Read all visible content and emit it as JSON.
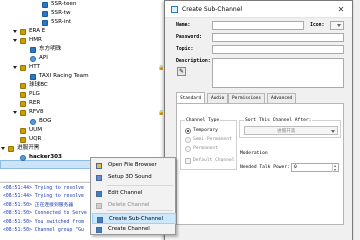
{
  "tree": {
    "rows": [
      {
        "label": "5SR-teen",
        "level": 3,
        "icon": "blue",
        "caret": false,
        "bold": false
      },
      {
        "label": "5SR-tw",
        "level": 3,
        "icon": "blue",
        "caret": false,
        "bold": false
      },
      {
        "label": "5SR-int",
        "level": 3,
        "icon": "blue",
        "caret": false,
        "bold": false
      },
      {
        "label": "ERA E",
        "level": 1,
        "icon": "yellow",
        "caret": true,
        "bold": false
      },
      {
        "label": "HMR",
        "level": 1,
        "icon": "yellow",
        "caret": true,
        "bold": false
      },
      {
        "label": "东方明珠",
        "level": 2,
        "icon": "blue",
        "caret": false,
        "bold": false
      },
      {
        "label": "API",
        "level": 2,
        "icon": "user",
        "caret": false,
        "bold": false
      },
      {
        "label": "HTT",
        "level": 1,
        "icon": "yellow",
        "caret": true,
        "bold": false
      },
      {
        "label": "TAXI Racing Team",
        "level": 2,
        "icon": "blue",
        "caret": false,
        "bold": false
      },
      {
        "label": "球球BC",
        "level": 1,
        "icon": "yellow",
        "caret": false,
        "bold": false
      },
      {
        "label": "PLG",
        "level": 1,
        "icon": "yellow",
        "caret": false,
        "bold": false
      },
      {
        "label": "RER",
        "level": 1,
        "icon": "yellow",
        "caret": false,
        "bold": false
      },
      {
        "label": "RFV8",
        "level": 1,
        "icon": "yellow",
        "caret": true,
        "bold": false
      },
      {
        "label": "BOG",
        "level": 2,
        "icon": "user",
        "caret": false,
        "bold": false
      },
      {
        "label": "UUM",
        "level": 1,
        "icon": "yellow",
        "caret": false,
        "bold": false
      },
      {
        "label": "UQR",
        "level": 1,
        "icon": "yellow",
        "caret": false,
        "bold": false
      },
      {
        "label": "进服开黑",
        "level": 0,
        "icon": "yellow",
        "caret": true,
        "bold": false
      },
      {
        "label": "hacker303",
        "level": 1,
        "icon": "user",
        "caret": false,
        "bold": true
      }
    ]
  },
  "chat": {
    "lines": [
      "<08:51:44> Trying to resolve",
      "<08:51:44> Trying to resolve",
      "<08:51:50> 正在连接到服务器",
      "<08:51:50> Connected to Serve",
      "<08:51:50> You switched from",
      "<08:51:50> Channel group \"Gu"
    ]
  },
  "context_menu": {
    "items": [
      {
        "label": "Open File Browser",
        "icon": "folder-icon",
        "disabled": false,
        "highlight": false
      },
      {
        "label": "Setup 3D Sound",
        "icon": "sound-icon",
        "disabled": false,
        "highlight": false
      },
      {
        "label": "Edit Channel",
        "icon": "edit-icon",
        "disabled": false,
        "highlight": false
      },
      {
        "label": "Delete Channel",
        "icon": "delete-icon",
        "disabled": true,
        "highlight": false
      },
      {
        "label": "Create Sub-Channel",
        "icon": "add-subchannel-icon",
        "disabled": false,
        "highlight": true
      },
      {
        "label": "Create Channel",
        "icon": "add-channel-icon",
        "disabled": false,
        "highlight": false
      }
    ]
  },
  "dialog": {
    "title": "Create Sub-Channel",
    "close_glyph": "✕",
    "fields": {
      "name_label": "Name:",
      "icon_label": "Icon:",
      "password_label": "Password:",
      "topic_label": "Topic:",
      "description_label": "Description:"
    },
    "tabs": [
      "Standard",
      "Audio",
      "Permissions",
      "Advanced"
    ],
    "channel_type": {
      "title": "Channel Type",
      "options": [
        {
          "label": "Temporary",
          "selected": true,
          "disabled": false
        },
        {
          "label": "Semi-Permanent",
          "selected": false,
          "disabled": true
        },
        {
          "label": "Permanent",
          "selected": false,
          "disabled": true
        }
      ],
      "default_channel": "Default Channel"
    },
    "sort": {
      "title": "Sort This Channel After:",
      "value": "进服开黑"
    },
    "moderation_label": "Moderation",
    "talk_power": {
      "label": "Needed Talk Power:",
      "value": "0"
    }
  }
}
